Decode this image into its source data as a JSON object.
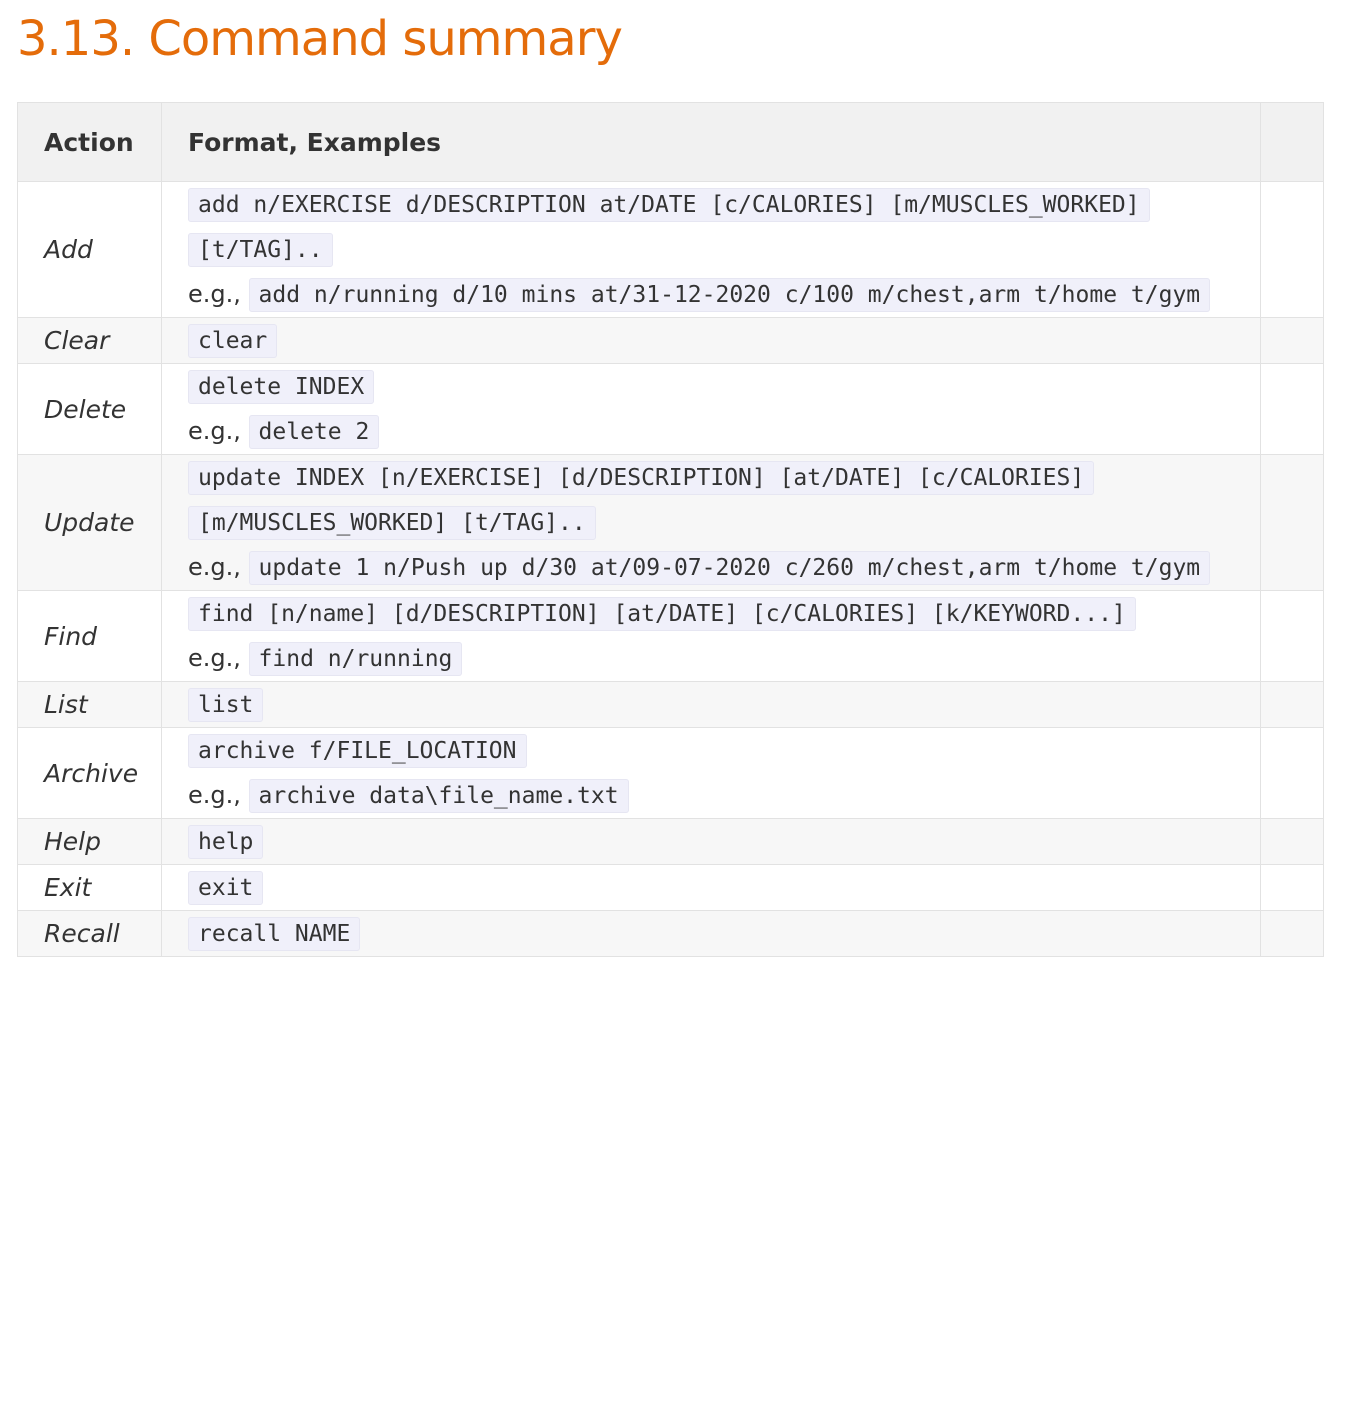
{
  "section": {
    "title": "3.13. Command summary",
    "title_color": "#e46c0a"
  },
  "table": {
    "headers": {
      "action": "Action",
      "format": "Format, Examples",
      "extra": ""
    },
    "eg_prefix": "e.g.,",
    "rows": [
      {
        "action": "Add",
        "format": "add n/EXERCISE d/DESCRIPTION at/DATE [c/CALORIES] [m/MUSCLES_WORKED] [t/TAG]..",
        "example": "add n/running d/10 mins at/31-12-2020 c/100 m/chest,arm t/home t/gym"
      },
      {
        "action": "Clear",
        "format": "clear",
        "example": ""
      },
      {
        "action": "Delete",
        "format": "delete INDEX",
        "example": "delete 2"
      },
      {
        "action": "Update",
        "format": "update INDEX [n/EXERCISE] [d/DESCRIPTION] [at/DATE] [c/CALORIES] [m/MUSCLES_WORKED] [t/TAG]..",
        "example": "update 1 n/Push up d/30 at/09-07-2020 c/260 m/chest,arm t/home t/gym"
      },
      {
        "action": "Find",
        "format": "find [n/name] [d/DESCRIPTION] [at/DATE] [c/CALORIES] [k/KEYWORD...]",
        "example": "find n/running"
      },
      {
        "action": "List",
        "format": "list",
        "example": ""
      },
      {
        "action": "Archive",
        "format": "archive f/FILE_LOCATION",
        "example": "archive data\\file_name.txt"
      },
      {
        "action": "Help",
        "format": "help",
        "example": ""
      },
      {
        "action": "Exit",
        "format": "exit",
        "example": ""
      },
      {
        "action": "Recall",
        "format": "recall NAME",
        "example": ""
      }
    ]
  }
}
